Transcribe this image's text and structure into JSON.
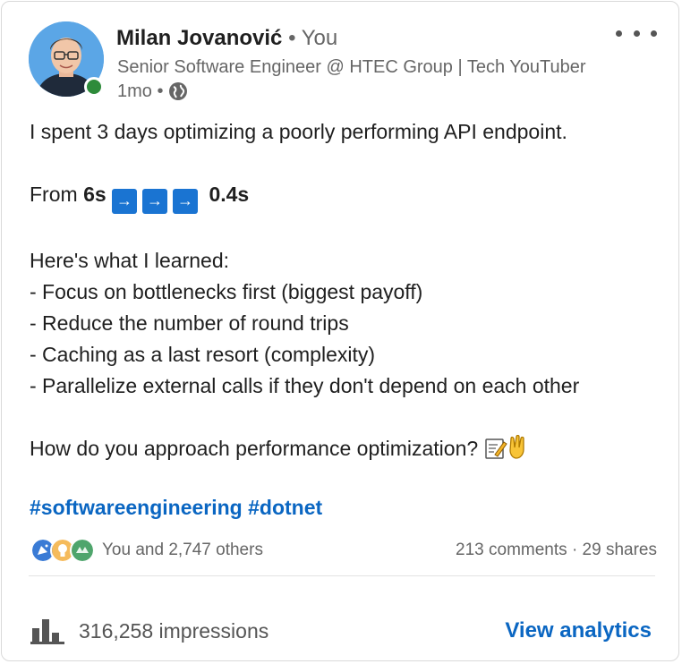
{
  "post": {
    "author": {
      "name": "Milan Jovanović",
      "relation": "• You",
      "headline": "Senior Software Engineer @ HTEC Group | Tech YouTuber",
      "time": "1mo •"
    },
    "body": {
      "line1": "I spent 3 days optimizing a poorly performing API endpoint.",
      "from_word": "From",
      "from_value": "6s",
      "to_value": "0.4s",
      "arrow_glyph": "→",
      "learned_intro": "Here's what I learned:",
      "points": [
        "- Focus on bottlenecks first (biggest payoff)",
        "- Reduce the number of round trips",
        "- Caching as a last resort (complexity)",
        "- Parallelize external calls if they don't depend on each other"
      ],
      "question": "How do you approach performance optimization?",
      "question_emojis": [
        "memo-icon",
        "pointing-down-icon"
      ]
    },
    "hashtags": [
      "#softwareengineering",
      "#dotnet"
    ],
    "social": {
      "reactions_text": "You and 2,747 others",
      "reaction_icons": [
        "celebrate-icon",
        "insightful-icon",
        "support-icon"
      ],
      "comments": "213 comments",
      "separator": "·",
      "shares": "29 shares"
    },
    "analytics": {
      "impressions": "316,258 impressions",
      "link": "View analytics"
    }
  },
  "colors": {
    "link": "#0a66c2",
    "arrow_box": "#1a74d2",
    "presence": "#2e8b3a",
    "muted_text": "#666666"
  }
}
